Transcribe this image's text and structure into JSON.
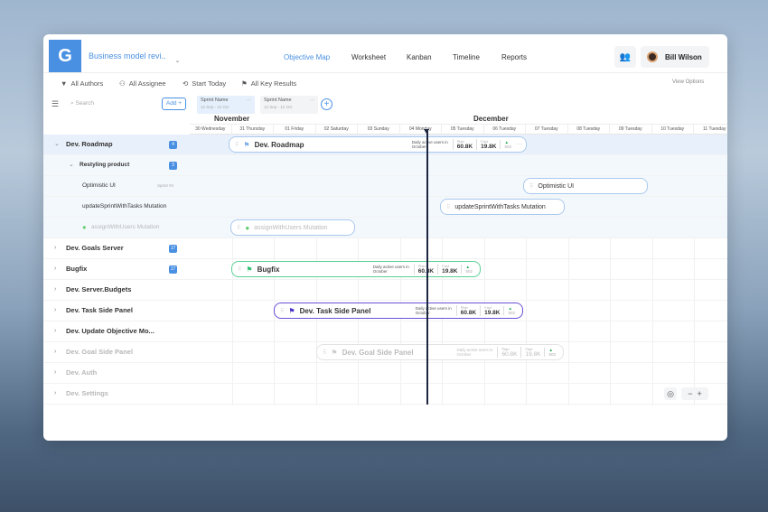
{
  "header": {
    "logo": "G",
    "project": "Business model revi..",
    "nav": [
      {
        "label": "Objective Map",
        "active": true
      },
      {
        "label": "Worksheet"
      },
      {
        "label": "Kanban"
      },
      {
        "label": "Timeline"
      },
      {
        "label": "Reports"
      }
    ],
    "user": "Bill Wilson"
  },
  "toolbar": {
    "authors": "All Authors",
    "assignee": "All Assignee",
    "start_today": "Start Today",
    "key_results": "All Key Results",
    "view_options": "View Options"
  },
  "subbar": {
    "search_placeholder": "Search",
    "add": "Add +",
    "sprints": [
      {
        "name": "Sprint Name",
        "dates": "12 Sep - 12 Oct",
        "active": true
      },
      {
        "name": "Sprint Name",
        "dates": "12 Sep - 12 Oct"
      }
    ]
  },
  "timeline": {
    "months": [
      "November",
      "December"
    ],
    "days": [
      "30 Wednesday",
      "31 Thursday",
      "01 Friday",
      "02 Saturday",
      "03 Sunday",
      "04 Monday",
      "05 Tuesday",
      "06 Tuesday",
      "07 Tuesday",
      "08 Tuesday",
      "09 Tuesday",
      "10 Tuesday",
      "11 Tuesday"
    ]
  },
  "rows": [
    {
      "label": "Dev. Roadmap",
      "badge": "4",
      "level": 0,
      "expanded": true
    },
    {
      "label": "Restyling product",
      "badge": "3",
      "level": 1,
      "expanded": true
    },
    {
      "label": "Optimistic UI",
      "tag": "Sprint #2",
      "level": 2
    },
    {
      "label": "updateSprintWithTasks Mutation",
      "level": 2
    },
    {
      "label": "assignWithUsers Mutation",
      "level": 2,
      "done": true
    },
    {
      "label": "Dev. Goals Server",
      "badge": "17",
      "level": 0
    },
    {
      "label": "Bugfix",
      "badge": "17",
      "level": 0
    },
    {
      "label": "Dev. Server.Budgets",
      "level": 0
    },
    {
      "label": "Dev. Task Side Panel",
      "level": 0
    },
    {
      "label": "Dev. Update Objective Mo...",
      "level": 0
    },
    {
      "label": "Dev. Goal Side Panel",
      "level": 0,
      "faded": true
    },
    {
      "label": "Dev. Auth",
      "level": 0,
      "faded": true
    },
    {
      "label": "Dev. Settings",
      "level": 0,
      "faded": true
    }
  ],
  "bars": [
    {
      "title": "Dev. Roadmap",
      "color": "#a9c8ec",
      "flag_color": "#7fb0e8",
      "kr": {
        "label": "Daily active users in October",
        "plan_caption": "Plan",
        "plan": "60.8K",
        "fact_caption": "Fact",
        "fact": "19.8K",
        "delta": "502",
        "more": "···"
      }
    },
    {
      "title": "Optimistic UI"
    },
    {
      "title": "updateSprintWithTasks Mutation"
    },
    {
      "title": "assignWithUsers Mutation",
      "done": true
    },
    {
      "title": "Bugfix",
      "color": "#5ccf95",
      "flag_color": "#2fbf71",
      "kr": {
        "label": "Daily active users in October",
        "plan_caption": "Plan",
        "plan": "60.8K",
        "fact_caption": "Fact",
        "fact": "19.8K",
        "delta": "502"
      }
    },
    {
      "title": "Dev. Task Side Panel",
      "color": "#6b4fd8",
      "flag_color": "#4b2fc8",
      "kr": {
        "label": "Daily active users in October",
        "plan_caption": "Plan",
        "plan": "60.8K",
        "fact_caption": "Fact",
        "fact": "19.8K",
        "delta": "502"
      }
    },
    {
      "title": "Dev. Goal Side Panel",
      "color": "#e3e3e3",
      "faded": true,
      "kr": {
        "label": "Daily active users in October",
        "plan_caption": "Plan",
        "plan": "60.8K",
        "fact_caption": "Fact",
        "fact": "19.8K",
        "delta": "502"
      }
    }
  ],
  "zoom": {
    "minus": "−",
    "plus": "+"
  }
}
